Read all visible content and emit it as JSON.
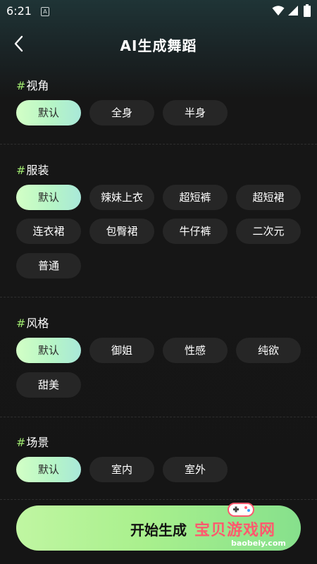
{
  "status_bar": {
    "time": "6:21",
    "app_badge": "A"
  },
  "header": {
    "title": "AI生成舞蹈"
  },
  "sections": [
    {
      "hash": "#",
      "title": "视角",
      "options": [
        "默认",
        "全身",
        "半身"
      ],
      "selected": "默认"
    },
    {
      "hash": "#",
      "title": "服装",
      "options": [
        "默认",
        "辣妹上衣",
        "超短裤",
        "超短裙",
        "连衣裙",
        "包臀裙",
        "牛仔裤",
        "二次元",
        "普通"
      ],
      "selected": "默认"
    },
    {
      "hash": "#",
      "title": "风格",
      "options": [
        "默认",
        "御姐",
        "性感",
        "纯欲",
        "甜美"
      ],
      "selected": "默认"
    },
    {
      "hash": "#",
      "title": "场景",
      "options": [
        "默认",
        "室内",
        "室外"
      ],
      "selected": "默认"
    }
  ],
  "start_button": {
    "label": "开始生成"
  },
  "watermark": {
    "main": "宝贝游戏网",
    "sub": "baobeiy.com"
  },
  "colors": {
    "accent_green": "#9fe870",
    "chip_bg": "#262626",
    "background": "#151515",
    "watermark_red": "#ff5a6e"
  },
  "icons": {
    "back": "chevron-left-icon",
    "wifi": "wifi-icon",
    "signal": "signal-icon",
    "battery": "battery-icon"
  }
}
